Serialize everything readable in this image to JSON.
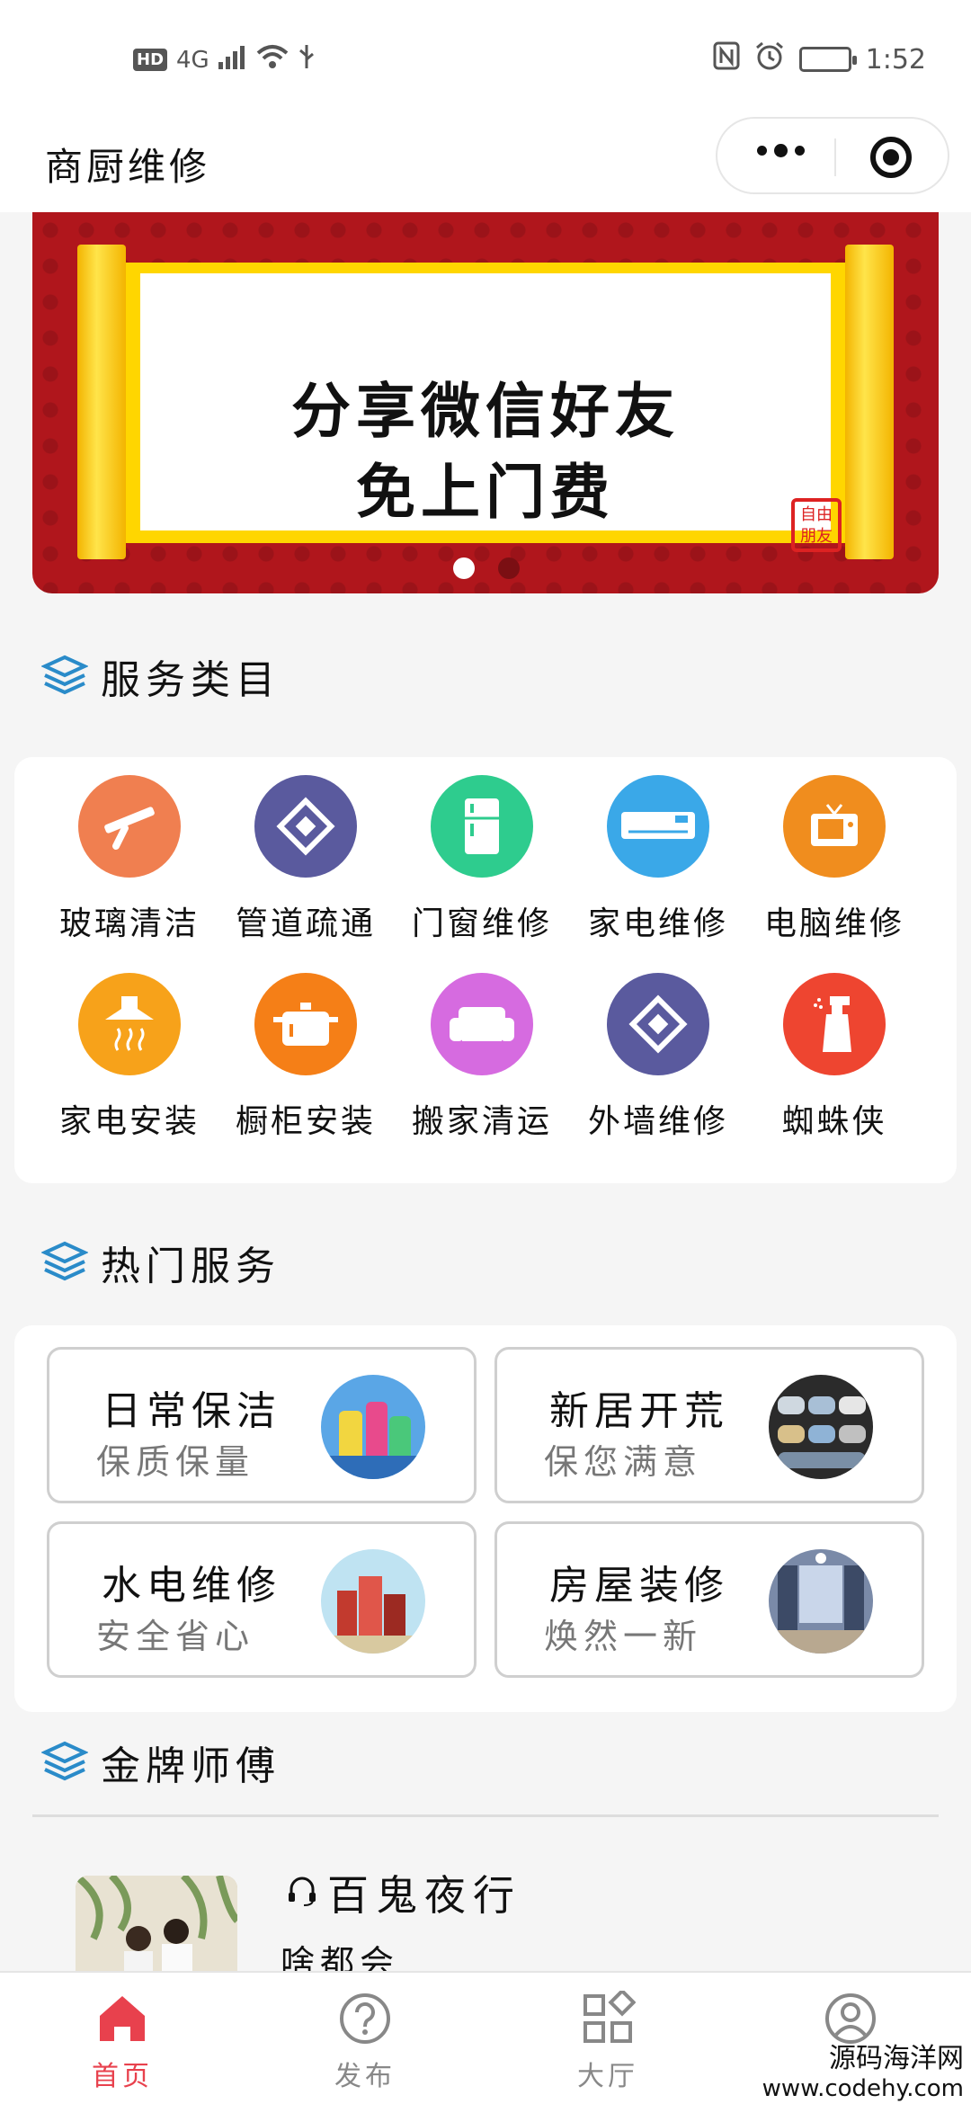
{
  "status_bar": {
    "left_badge": "HD",
    "network": "4G",
    "time": "1:52"
  },
  "header": {
    "title": "商厨维修"
  },
  "banner": {
    "line1": "分享微信好友",
    "line2": "免上门费",
    "seal": "自由朋友",
    "slide_count": 2,
    "active_slide": 1
  },
  "sections": {
    "categories_title": "服务类目",
    "hot_title": "热门服务",
    "masters_title": "金牌师傅"
  },
  "categories": [
    {
      "label": "玻璃清洁",
      "color": "#f07f50",
      "icon": "squeegee-icon"
    },
    {
      "label": "管道疏通",
      "color": "#5a5a9e",
      "icon": "diamond-pattern-icon"
    },
    {
      "label": "门窗维修",
      "color": "#2ecc8e",
      "icon": "fridge-icon"
    },
    {
      "label": "家电维修",
      "color": "#3aa8e8",
      "icon": "air-conditioner-icon"
    },
    {
      "label": "电脑维修",
      "color": "#f08d1e",
      "icon": "tv-icon"
    },
    {
      "label": "家电安装",
      "color": "#f7a21a",
      "icon": "range-hood-icon"
    },
    {
      "label": "橱柜安装",
      "color": "#f57f17",
      "icon": "pot-icon"
    },
    {
      "label": "搬家清运",
      "color": "#d66be0",
      "icon": "sofa-icon"
    },
    {
      "label": "外墙维修",
      "color": "#5a5a9e",
      "icon": "diamond-pattern-icon"
    },
    {
      "label": "蜘蛛侠",
      "color": "#ee4530",
      "icon": "spray-bottle-icon"
    }
  ],
  "hot_services": [
    {
      "title": "日常保洁",
      "subtitle": "保质保量",
      "thumb": "cleaning-supplies-image"
    },
    {
      "title": "新居开荒",
      "subtitle": "保您满意",
      "thumb": "towels-image"
    },
    {
      "title": "水电维修",
      "subtitle": "安全省心",
      "thumb": "buildings-image"
    },
    {
      "title": "房屋装修",
      "subtitle": "焕然一新",
      "thumb": "interior-image"
    }
  ],
  "master": {
    "name": "百鬼夜行",
    "skill": "啥都会",
    "icon": "headset-icon"
  },
  "tabbar": {
    "tabs": [
      {
        "label": "首页",
        "icon": "home-icon",
        "active": true
      },
      {
        "label": "发布",
        "icon": "question-icon",
        "active": false
      },
      {
        "label": "大厅",
        "icon": "grid-icon",
        "active": false
      },
      {
        "label": "",
        "icon": "user-icon",
        "active": false
      }
    ]
  },
  "watermark": {
    "line1": "源码海洋网",
    "line2": "www.codehy.com"
  },
  "colors": {
    "accent": "#e8414d",
    "banner_red": "#b0161c",
    "scroll_yellow": "#ffd600",
    "section_icon": "#2a8bc9"
  }
}
